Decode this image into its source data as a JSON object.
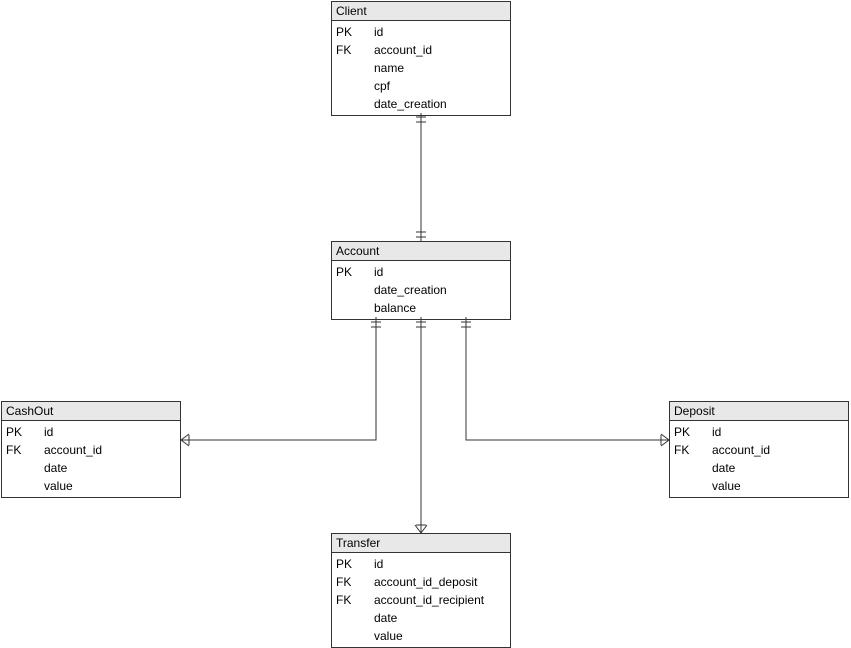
{
  "entities": {
    "client": {
      "title": "Client",
      "rows": [
        {
          "key": "PK",
          "name": "id"
        },
        {
          "key": "FK",
          "name": "account_id"
        },
        {
          "key": "",
          "name": "name"
        },
        {
          "key": "",
          "name": "cpf"
        },
        {
          "key": "",
          "name": "date_creation"
        }
      ]
    },
    "account": {
      "title": "Account",
      "rows": [
        {
          "key": "PK",
          "name": "id"
        },
        {
          "key": "",
          "name": "date_creation"
        },
        {
          "key": "",
          "name": "balance"
        }
      ]
    },
    "cashout": {
      "title": "CashOut",
      "rows": [
        {
          "key": "PK",
          "name": "id"
        },
        {
          "key": "FK",
          "name": "account_id"
        },
        {
          "key": "",
          "name": "date"
        },
        {
          "key": "",
          "name": "value"
        }
      ]
    },
    "deposit": {
      "title": "Deposit",
      "rows": [
        {
          "key": "PK",
          "name": "id"
        },
        {
          "key": "FK",
          "name": "account_id"
        },
        {
          "key": "",
          "name": "date"
        },
        {
          "key": "",
          "name": "value"
        }
      ]
    },
    "transfer": {
      "title": "Transfer",
      "rows": [
        {
          "key": "PK",
          "name": "id"
        },
        {
          "key": "FK",
          "name": "account_id_deposit"
        },
        {
          "key": "FK",
          "name": "account_id_recipient"
        },
        {
          "key": "",
          "name": "date"
        },
        {
          "key": "",
          "name": "value"
        }
      ]
    }
  }
}
